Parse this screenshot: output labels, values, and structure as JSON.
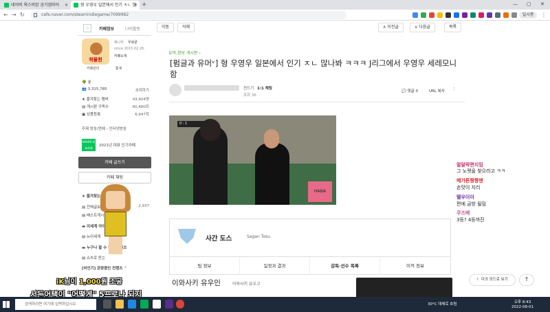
{
  "browser": {
    "tabs": [
      {
        "label": "네이버 윅스비앙 공기엄마어",
        "close": "×"
      },
      {
        "label": "형 우영우 일본에서 인기 ㅈㄴ 많",
        "close": "×"
      }
    ],
    "new_tab": "+",
    "url": "cafe.naver.com/steamindiegame/7099982",
    "profile": "일시중"
  },
  "sidebar": {
    "tabs": [
      "카페정보",
      "나의활동"
    ],
    "logo_text": "왁물원",
    "manager_label": "매니저",
    "manager_name": "우왁굳",
    "since": "since 2015.02.26.",
    "intro": "카페소개",
    "links": [
      "카페관리",
      "통계"
    ],
    "level": "숲",
    "members_label": "3,315,785",
    "invite": "초대하기",
    "stats": [
      {
        "label": "즐겨찾는 멤버",
        "value": "43,404명"
      },
      {
        "label": "게시판 구독수",
        "value": "60,480회"
      },
      {
        "label": "상품등록",
        "value": "6,947회"
      }
    ],
    "topics": "주제 방송/연예 › 인터넷방송",
    "naver_badge": "NAVER 대표카페",
    "award": "2021년 대표 인기카페",
    "write_button": "카페 글쓰기",
    "chat_button": "카페 채팅",
    "menu": [
      {
        "label": "즐겨찾는 게시판"
      },
      {
        "label": "전체글보기",
        "value": "2,937"
      },
      {
        "label": "베스트게시물"
      },
      {
        "label": "이세계 아이돌"
      },
      {
        "label": "뉴이세계"
      },
      {
        "label": "누구나 할 수 있는 컨텐츠"
      },
      {
        "label": "쇼츠로 듣는"
      },
      {
        "label": "[비인기] 관광중인 컨텐츠"
      }
    ]
  },
  "article": {
    "toolbar": {
      "move": "이동",
      "delete": "삭제",
      "prev": "∧ 이전글",
      "next": "∨ 다음글",
      "list": "목록"
    },
    "category": "유머,정보 게시판 ›",
    "title": "[펌글과 유머ᵛ] 형 우영우 일본에서 인기 ㅈㄴ 많나봐 ㅋㅋㅋ J리그에서 우영우 세레모니 함",
    "author_level": "1:1 채팅",
    "author_tag": "전드기",
    "date_hint": "조회 36",
    "comments": "댓글 0",
    "url_copy": "URL 복사",
    "more": "⋮",
    "photo": {
      "score": "0 : 1",
      "sign": "HANA"
    },
    "team_card": {
      "name_kr": "사간 도스",
      "name_en": "Sagan Tosu",
      "tabs": [
        "팀 정보",
        "일정과 결과",
        "감독·선수 목록",
        "이적 정보"
      ]
    },
    "player_name": "이와사키 유우인",
    "player_sub": "이와사키 유우고"
  },
  "floating": {
    "dark_mode": "☾ 다크 모드로 보기",
    "to_top": "↑"
  },
  "chat": [
    {
      "user": "멀말략편지밈",
      "msg": "그 노랫을 찾으라고 ㅋㅋ",
      "color": "#c0306a"
    },
    {
      "user": "메가톤짱짱맨",
      "msg": "손맛이 지리",
      "color": "#e0202a"
    },
    {
      "user": "텔우이이",
      "msg": "편에 금방 될밈",
      "color": "#6a30a0"
    },
    {
      "user": "쿠즈베",
      "msg": "3등? 4등까진",
      "color": "#c050a0"
    }
  ],
  "overlay": {
    "donation_name": "iK",
    "donation_text_mid": "님이 ",
    "donation_amount": "1,000",
    "donation_tail": "원 조공",
    "subtitle": "서든어택이 \"어떻게\" 5프로나 되지"
  },
  "taskbar": {
    "search": "검색하려면 여기에 입력하십시오.",
    "weather": "30°C 대체로 흐림",
    "time": "오후 8:43",
    "date": "2022-08-01"
  }
}
